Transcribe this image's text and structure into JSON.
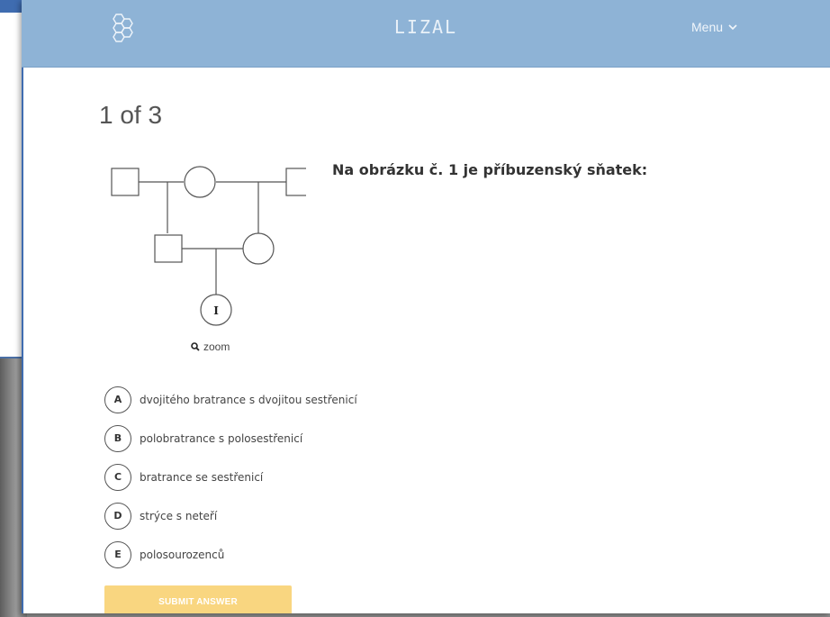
{
  "header": {
    "brand": "LIZAL",
    "menu_label": "Menu",
    "logo_icon": "hexagon-molecule-icon"
  },
  "quiz": {
    "progress": "1 of 3",
    "question": "Na obrázku č. 1 je příbuzenský sňatek:",
    "zoom_label": "zoom",
    "pedigree_marker": "I",
    "options": [
      {
        "letter": "A",
        "text": "dvojitého bratrance s dvojitou sestřenicí"
      },
      {
        "letter": "B",
        "text": "polobratrance s polosestřenicí"
      },
      {
        "letter": "C",
        "text": "bratrance se sestřenicí"
      },
      {
        "letter": "D",
        "text": "strýce s neteří"
      },
      {
        "letter": "E",
        "text": "polosourozenců"
      }
    ],
    "submit_label": "SUBMIT ANSWER"
  },
  "colors": {
    "header_bg": "#8eb3d6",
    "submit_bg": "#f9d680",
    "window_accent": "#3f6cb0"
  }
}
